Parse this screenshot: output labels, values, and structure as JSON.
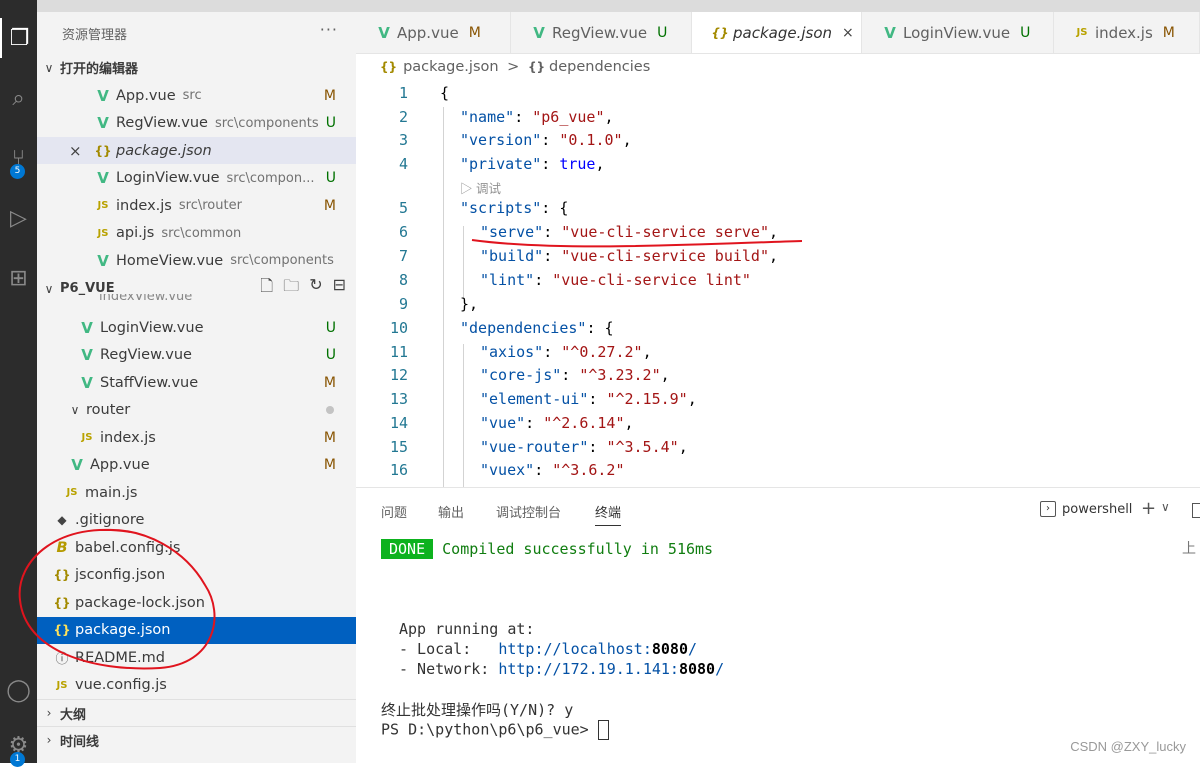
{
  "explorer": {
    "title": "资源管理器",
    "more": "···",
    "open_editors_label": "打开的编辑器",
    "open_editors": [
      {
        "icon": "vue",
        "name": "App.vue",
        "desc": "src",
        "status": "M"
      },
      {
        "icon": "vue",
        "name": "RegView.vue",
        "desc": "src\\components",
        "status": "U"
      },
      {
        "icon": "json",
        "name": "package.json",
        "desc": "",
        "status": "",
        "close": "×"
      },
      {
        "icon": "vue",
        "name": "LoginView.vue",
        "desc": "src\\compon...",
        "status": "U"
      },
      {
        "icon": "js",
        "name": "index.js",
        "desc": "src\\router",
        "status": "M"
      },
      {
        "icon": "js",
        "name": "api.js",
        "desc": "src\\common",
        "status": ""
      },
      {
        "icon": "vue",
        "name": "HomeView.vue",
        "desc": "src\\components",
        "status": ""
      }
    ],
    "project_label": "P6_VUE",
    "tree_partial": "indexView.vue",
    "tree": [
      {
        "icon": "vue",
        "name": "LoginView.vue",
        "status": "U"
      },
      {
        "icon": "vue",
        "name": "RegView.vue",
        "status": "U"
      },
      {
        "icon": "vue",
        "name": "StaffView.vue",
        "status": "M"
      },
      {
        "icon": "folder",
        "name": "router",
        "status": "dot"
      },
      {
        "icon": "js",
        "name": "index.js",
        "status": "M"
      },
      {
        "icon": "vue",
        "name": "App.vue",
        "status": "M"
      },
      {
        "icon": "js",
        "name": "main.js",
        "status": ""
      },
      {
        "icon": "git",
        "name": ".gitignore",
        "status": ""
      },
      {
        "icon": "babel",
        "name": "babel.config.js",
        "status": ""
      },
      {
        "icon": "json",
        "name": "jsconfig.json",
        "status": ""
      },
      {
        "icon": "json",
        "name": "package-lock.json",
        "status": ""
      },
      {
        "icon": "json",
        "name": "package.json",
        "status": ""
      },
      {
        "icon": "info",
        "name": "README.md",
        "status": ""
      },
      {
        "icon": "js",
        "name": "vue.config.js",
        "status": ""
      }
    ],
    "outline_label": "大纲",
    "timeline_label": "时间线"
  },
  "activity": {
    "scm_badge": "5",
    "account_badge": "1"
  },
  "tabs": [
    {
      "icon": "vue",
      "label": "App.vue",
      "status": "M"
    },
    {
      "icon": "vue",
      "label": "RegView.vue",
      "status": "U"
    },
    {
      "icon": "json",
      "label": "package.json",
      "status": "×"
    },
    {
      "icon": "vue",
      "label": "LoginView.vue",
      "status": "U"
    },
    {
      "icon": "js",
      "label": "index.js",
      "status": "M"
    }
  ],
  "breadcrumb": {
    "file": "package.json",
    "sep": ">",
    "node": "dependencies"
  },
  "editor": {
    "line_numbers": [
      "1",
      "2",
      "3",
      "4",
      "5",
      "6",
      "7",
      "8",
      "9",
      "10",
      "11",
      "12",
      "13",
      "14",
      "15",
      "16"
    ],
    "codelens": "调试"
  },
  "panel": {
    "tabs": [
      "问题",
      "输出",
      "调试控制台",
      "终端"
    ],
    "active_tab": "终端",
    "shell": "powershell",
    "done_badge": "DONE",
    "compiled_msg": "Compiled successfully in 516ms",
    "running_at": "App running at:",
    "local_label": "- Local:   ",
    "local_url": "http://localhost:",
    "local_port": "8080",
    "network_label": "- Network: ",
    "network_url": "http://172.19.1.141:",
    "network_port": "8080",
    "prompt_terminate": "终止批处理操作吗(Y/N)? y",
    "ps_prompt": "PS D:\\python\\p6\\p6_vue> ",
    "scroll_up": "上",
    "watermark": "CSDN @ZXY_lucky"
  },
  "colors": {
    "accent": "#0060c0",
    "vue": "#41b883",
    "modified": "#895503",
    "untracked": "#007100",
    "annotation": "#e0141e"
  }
}
